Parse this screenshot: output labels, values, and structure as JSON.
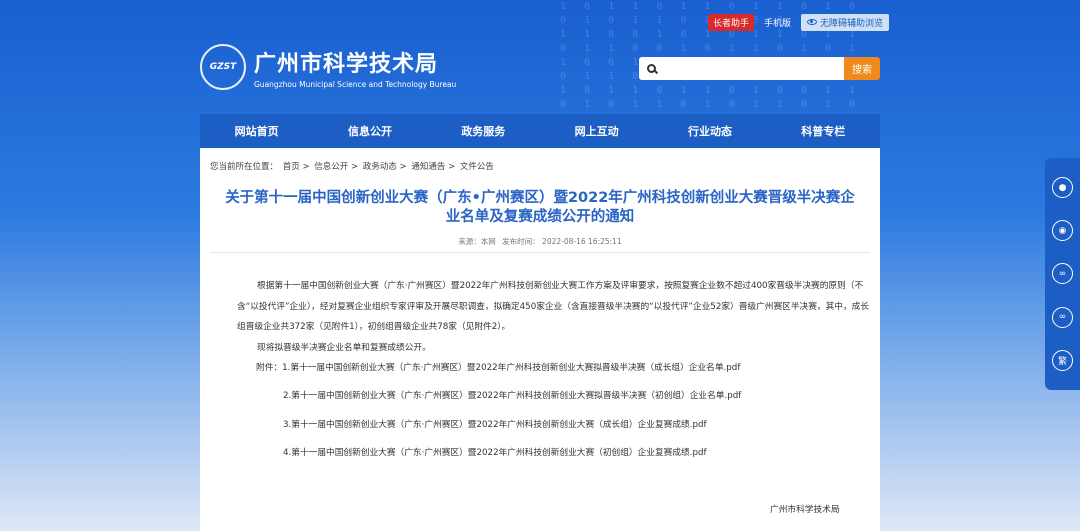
{
  "topbar": {
    "elder_mode": "长者助手",
    "mobile": "手机版",
    "accessibility": "无障碍辅助浏览"
  },
  "logo": {
    "mark": "GZST",
    "title": "广州市科学技术局",
    "subtitle": "Guangzhou Municipal Science and Technology Bureau"
  },
  "search": {
    "placeholder": "",
    "button": "搜索"
  },
  "nav": [
    "网站首页",
    "信息公开",
    "政务服务",
    "网上互动",
    "行业动态",
    "科普专栏"
  ],
  "breadcrumb": {
    "prefix": "您当前所在位置：",
    "items": [
      "首页",
      "信息公开",
      "政务动态",
      "通知通告",
      "文件公告"
    ],
    "separator": ">"
  },
  "article": {
    "title": "关于第十一届中国创新创业大赛（广东•广州赛区）暨2022年广州科技创新创业大赛晋级半决赛企业名单及复赛成绩公开的通知",
    "source": "来源：本网",
    "published": "发布时间：  2022-08-16 16:25:11",
    "paragraph1": "根据第十一届中国创新创业大赛（广东·广州赛区）暨2022年广州科技创新创业大赛工作方案及评审要求，按照复赛企业数不超过400家晋级半决赛的原则（不含“以投代评”企业），经对复赛企业组织专家评审及开展尽职调查，拟确定450家企业（含直接晋级半决赛的“以投代评”企业52家）晋级广州赛区半决赛，其中，成长组晋级企业共372家（见附件1），初创组晋级企业共78家（见附件2）。",
    "paragraph2": "现将拟晋级半决赛企业名单和复赛成绩公开。",
    "attachments": [
      "附件：1.第十一届中国创新创业大赛（广东·广州赛区）暨2022年广州科技创新创业大赛拟晋级半决赛（成长组）企业名单.pdf",
      "2.第十一届中国创新创业大赛（广东·广州赛区）暨2022年广州科技创新创业大赛拟晋级半决赛（初创组）企业名单.pdf",
      "3.第十一届中国创新创业大赛（广东·广州赛区）暨2022年广州科技创新创业大赛（成长组）企业复赛成绩.pdf",
      "4.第十一届中国创新创业大赛（广东·广州赛区）暨2022年广州科技创新创业大赛（初创组）企业复赛成绩.pdf"
    ],
    "signature": "广州市科学技术局"
  },
  "sidebar": [
    "wechat-icon",
    "weibo-icon",
    "share-icon",
    "link-icon",
    "繁"
  ]
}
